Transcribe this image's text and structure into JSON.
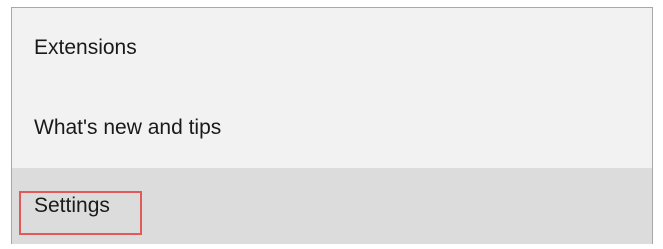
{
  "menu": {
    "items": [
      {
        "label": "Extensions"
      },
      {
        "label": "What's new and tips"
      },
      {
        "label": "Settings",
        "state": "hovered"
      }
    ]
  },
  "annotation": {
    "highlight_color": "#e05a5a",
    "highlight_target": "Settings"
  },
  "colors": {
    "menu_background": "#f2f2f2",
    "hover_background": "#dcdcdc",
    "border": "#a8a8a8"
  }
}
